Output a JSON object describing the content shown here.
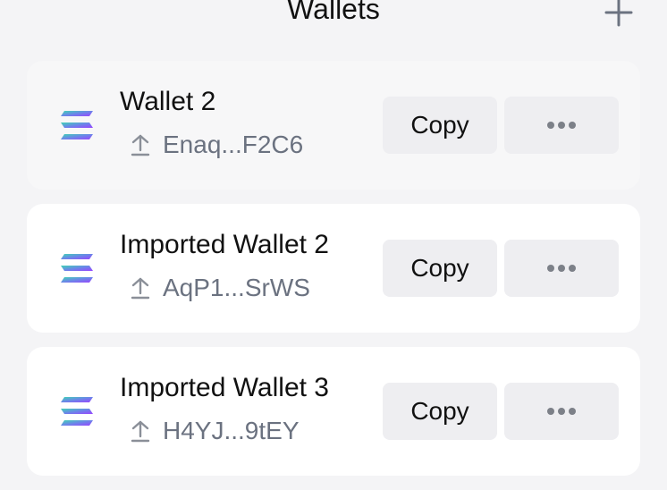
{
  "header": {
    "title": "Wallets",
    "add_icon": "plus-icon"
  },
  "wallets": [
    {
      "name": "Wallet 2",
      "address": "Enaq...F2C6",
      "copy_label": "Copy",
      "selected": true,
      "logo_icon": "solana-logo-icon",
      "address_icon": "upload-icon",
      "more_icon": "ellipsis-icon"
    },
    {
      "name": "Imported Wallet 2",
      "address": "AqP1...SrWS",
      "copy_label": "Copy",
      "selected": false,
      "logo_icon": "solana-logo-icon",
      "address_icon": "upload-icon",
      "more_icon": "ellipsis-icon"
    },
    {
      "name": "Imported Wallet 3",
      "address": "H4YJ...9tEY",
      "copy_label": "Copy",
      "selected": false,
      "logo_icon": "solana-logo-icon",
      "address_icon": "upload-icon",
      "more_icon": "ellipsis-icon"
    }
  ],
  "colors": {
    "background": "#f4f4f6",
    "card": "#ffffff",
    "card_selected": "#f7f7f8",
    "button": "#eeeef1",
    "text": "#111111",
    "muted": "#6b7280",
    "logo_gradient": [
      "#19fb9b",
      "#9945ff"
    ]
  }
}
